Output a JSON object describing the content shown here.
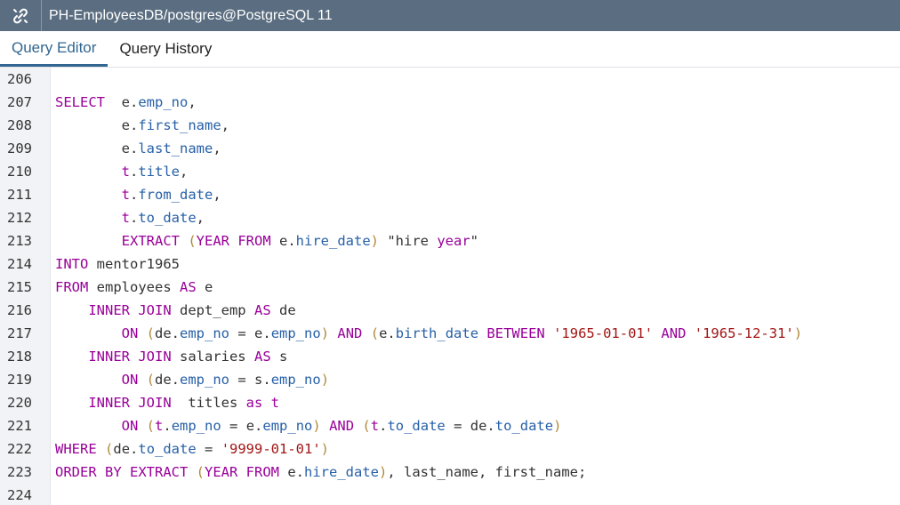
{
  "window": {
    "title": "PH-EmployeesDB/postgres@PostgreSQL 11",
    "icon": "link-icon"
  },
  "tabs": [
    {
      "label": "Query Editor",
      "active": true
    },
    {
      "label": "Query History",
      "active": false
    }
  ],
  "editor": {
    "lines": [
      {
        "num": "206",
        "tokens": []
      },
      {
        "num": "207",
        "tokens": [
          [
            "kw",
            "SELECT"
          ],
          [
            "",
            "  e."
          ],
          [
            "prop",
            "emp_no"
          ],
          [
            "",
            ","
          ]
        ]
      },
      {
        "num": "208",
        "tokens": [
          [
            "",
            "        e."
          ],
          [
            "prop",
            "first_name"
          ],
          [
            "",
            ","
          ]
        ]
      },
      {
        "num": "209",
        "tokens": [
          [
            "",
            "        e."
          ],
          [
            "prop",
            "last_name"
          ],
          [
            "",
            ","
          ]
        ]
      },
      {
        "num": "210",
        "tokens": [
          [
            "",
            "        "
          ],
          [
            "alias",
            "t"
          ],
          [
            "",
            "."
          ],
          [
            "prop",
            "title"
          ],
          [
            "",
            ","
          ]
        ]
      },
      {
        "num": "211",
        "tokens": [
          [
            "",
            "        "
          ],
          [
            "alias",
            "t"
          ],
          [
            "",
            "."
          ],
          [
            "prop",
            "from_date"
          ],
          [
            "",
            ","
          ]
        ]
      },
      {
        "num": "212",
        "tokens": [
          [
            "",
            "        "
          ],
          [
            "alias",
            "t"
          ],
          [
            "",
            "."
          ],
          [
            "prop",
            "to_date"
          ],
          [
            "",
            ","
          ]
        ]
      },
      {
        "num": "213",
        "tokens": [
          [
            "",
            "        "
          ],
          [
            "kw",
            "EXTRACT"
          ],
          [
            "",
            " "
          ],
          [
            "paren",
            "("
          ],
          [
            "kw",
            "YEAR FROM"
          ],
          [
            "",
            " e."
          ],
          [
            "prop",
            "hire_date"
          ],
          [
            "paren",
            ")"
          ],
          [
            "",
            " \"hire "
          ],
          [
            "kw",
            "year"
          ],
          [
            "",
            "\""
          ]
        ]
      },
      {
        "num": "214",
        "tokens": [
          [
            "kw",
            "INTO"
          ],
          [
            "",
            " mentor1965"
          ]
        ]
      },
      {
        "num": "215",
        "tokens": [
          [
            "kw",
            "FROM"
          ],
          [
            "",
            " employees "
          ],
          [
            "kw",
            "AS"
          ],
          [
            "",
            " e"
          ]
        ]
      },
      {
        "num": "216",
        "tokens": [
          [
            "",
            "    "
          ],
          [
            "kw",
            "INNER JOIN"
          ],
          [
            "",
            " dept_emp "
          ],
          [
            "kw",
            "AS"
          ],
          [
            "",
            " de"
          ]
        ]
      },
      {
        "num": "217",
        "tokens": [
          [
            "",
            "        "
          ],
          [
            "kw",
            "ON"
          ],
          [
            "",
            " "
          ],
          [
            "paren",
            "("
          ],
          [
            "",
            "de."
          ],
          [
            "prop",
            "emp_no"
          ],
          [
            "",
            " = e."
          ],
          [
            "prop",
            "emp_no"
          ],
          [
            "paren",
            ")"
          ],
          [
            "",
            " "
          ],
          [
            "kw",
            "AND"
          ],
          [
            "",
            " "
          ],
          [
            "paren",
            "("
          ],
          [
            "",
            "e."
          ],
          [
            "prop",
            "birth_date"
          ],
          [
            "",
            " "
          ],
          [
            "kw",
            "BETWEEN"
          ],
          [
            "",
            " "
          ],
          [
            "str",
            "'1965-01-01'"
          ],
          [
            "",
            " "
          ],
          [
            "kw",
            "AND"
          ],
          [
            "",
            " "
          ],
          [
            "str",
            "'1965-12-31'"
          ],
          [
            "paren",
            ")"
          ]
        ]
      },
      {
        "num": "218",
        "tokens": [
          [
            "",
            "    "
          ],
          [
            "kw",
            "INNER JOIN"
          ],
          [
            "",
            " salaries "
          ],
          [
            "kw",
            "AS"
          ],
          [
            "",
            " s"
          ]
        ]
      },
      {
        "num": "219",
        "tokens": [
          [
            "",
            "        "
          ],
          [
            "kw",
            "ON"
          ],
          [
            "",
            " "
          ],
          [
            "paren",
            "("
          ],
          [
            "",
            "de."
          ],
          [
            "prop",
            "emp_no"
          ],
          [
            "",
            " = s."
          ],
          [
            "prop",
            "emp_no"
          ],
          [
            "paren",
            ")"
          ]
        ]
      },
      {
        "num": "220",
        "tokens": [
          [
            "",
            "    "
          ],
          [
            "kw",
            "INNER JOIN"
          ],
          [
            "",
            "  titles "
          ],
          [
            "kw",
            "as"
          ],
          [
            "",
            " "
          ],
          [
            "alias",
            "t"
          ]
        ]
      },
      {
        "num": "221",
        "tokens": [
          [
            "",
            "        "
          ],
          [
            "kw",
            "ON"
          ],
          [
            "",
            " "
          ],
          [
            "paren",
            "("
          ],
          [
            "alias",
            "t"
          ],
          [
            "",
            "."
          ],
          [
            "prop",
            "emp_no"
          ],
          [
            "",
            " = e."
          ],
          [
            "prop",
            "emp_no"
          ],
          [
            "paren",
            ")"
          ],
          [
            "",
            " "
          ],
          [
            "kw",
            "AND"
          ],
          [
            "",
            " "
          ],
          [
            "paren",
            "("
          ],
          [
            "alias",
            "t"
          ],
          [
            "",
            "."
          ],
          [
            "prop",
            "to_date"
          ],
          [
            "",
            " = de."
          ],
          [
            "prop",
            "to_date"
          ],
          [
            "paren",
            ")"
          ]
        ]
      },
      {
        "num": "222",
        "tokens": [
          [
            "kw",
            "WHERE"
          ],
          [
            "",
            " "
          ],
          [
            "paren",
            "("
          ],
          [
            "",
            "de."
          ],
          [
            "prop",
            "to_date"
          ],
          [
            "",
            " = "
          ],
          [
            "str",
            "'9999-01-01'"
          ],
          [
            "paren",
            ")"
          ]
        ]
      },
      {
        "num": "223",
        "tokens": [
          [
            "kw",
            "ORDER BY"
          ],
          [
            "",
            " "
          ],
          [
            "kw",
            "EXTRACT"
          ],
          [
            "",
            " "
          ],
          [
            "paren",
            "("
          ],
          [
            "kw",
            "YEAR FROM"
          ],
          [
            "",
            " e."
          ],
          [
            "prop",
            "hire_date"
          ],
          [
            "paren",
            ")"
          ],
          [
            "",
            ", last_name, first_name;"
          ]
        ]
      },
      {
        "num": "224",
        "tokens": []
      }
    ]
  }
}
